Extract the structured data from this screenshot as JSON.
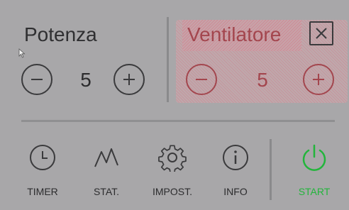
{
  "power": {
    "title": "Potenza",
    "value": "5"
  },
  "fan": {
    "title": "Ventilatore",
    "value": "5"
  },
  "nav": {
    "timer": "TIMER",
    "stat": "STAT.",
    "impost": "IMPOST.",
    "info": "INFO",
    "start": "START"
  },
  "icons": {
    "minus": "minus-icon",
    "plus": "plus-icon",
    "close": "close-icon",
    "timer": "clock-icon",
    "stat": "stats-icon",
    "impost": "gear-icon",
    "info": "info-icon",
    "start": "power-icon"
  },
  "colors": {
    "background": "#a8a7a9",
    "highlight": "#a3464e",
    "start": "#22b53b"
  }
}
